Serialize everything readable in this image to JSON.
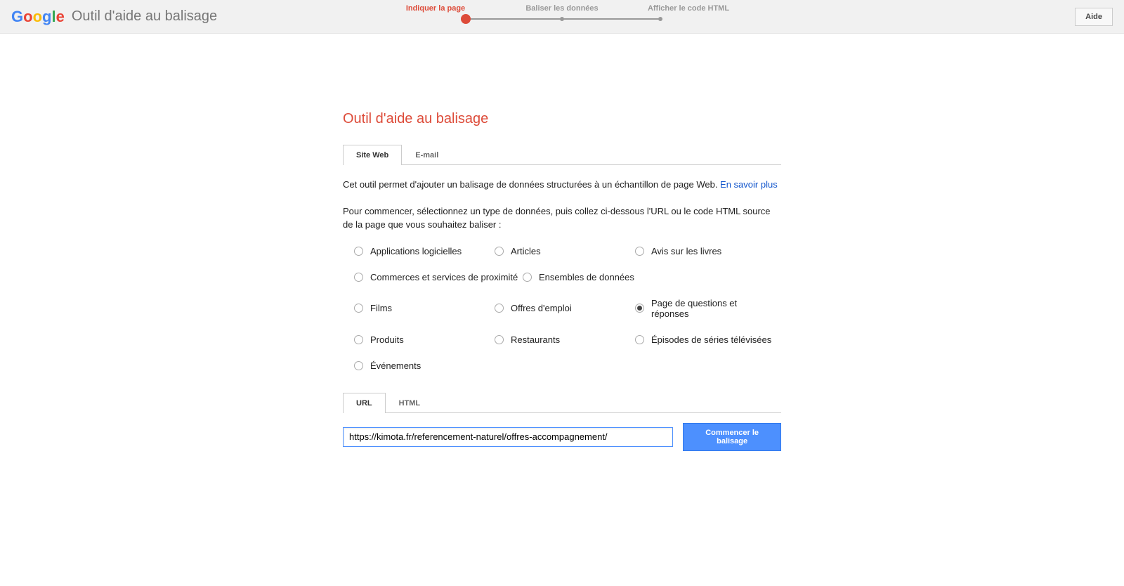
{
  "header": {
    "app_title": "Outil d'aide au balisage",
    "help_button": "Aide"
  },
  "stepper": {
    "steps": [
      "Indiquer la page",
      "Baliser les données",
      "Afficher le code HTML"
    ],
    "active_index": 0
  },
  "main": {
    "title": "Outil d'aide au balisage",
    "tabs_top": {
      "site": "Site Web",
      "email": "E-mail",
      "active": "site"
    },
    "description_1": "Cet outil permet d'ajouter un balisage de données structurées à un échantillon de page Web. ",
    "learn_more": "En savoir plus",
    "description_2": "Pour commencer, sélectionnez un type de données, puis collez ci-dessous l'URL ou le code HTML source de la page que vous souhaitez baliser :",
    "data_types": {
      "rows": [
        [
          {
            "id": "apps",
            "label": "Applications logicielles"
          },
          {
            "id": "articles",
            "label": "Articles"
          },
          {
            "id": "book_reviews",
            "label": "Avis sur les livres"
          }
        ],
        [
          {
            "id": "local",
            "label": "Commerces et services de proximité",
            "wide": true
          },
          {
            "id": "datasets",
            "label": "Ensembles de données"
          }
        ],
        [
          {
            "id": "films",
            "label": "Films"
          },
          {
            "id": "jobs",
            "label": "Offres d'emploi"
          },
          {
            "id": "qa",
            "label": "Page de questions et réponses"
          }
        ],
        [
          {
            "id": "products",
            "label": "Produits"
          },
          {
            "id": "restaurants",
            "label": "Restaurants"
          },
          {
            "id": "tv",
            "label": "Épisodes de séries télévisées"
          }
        ],
        [
          {
            "id": "events",
            "label": "Événements"
          }
        ]
      ],
      "selected": "qa"
    },
    "tabs_input": {
      "url": "URL",
      "html": "HTML",
      "active": "url"
    },
    "url_value": "https://kimota.fr/referencement-naturel/offres-accompagnement/",
    "start_button": "Commencer le balisage"
  }
}
